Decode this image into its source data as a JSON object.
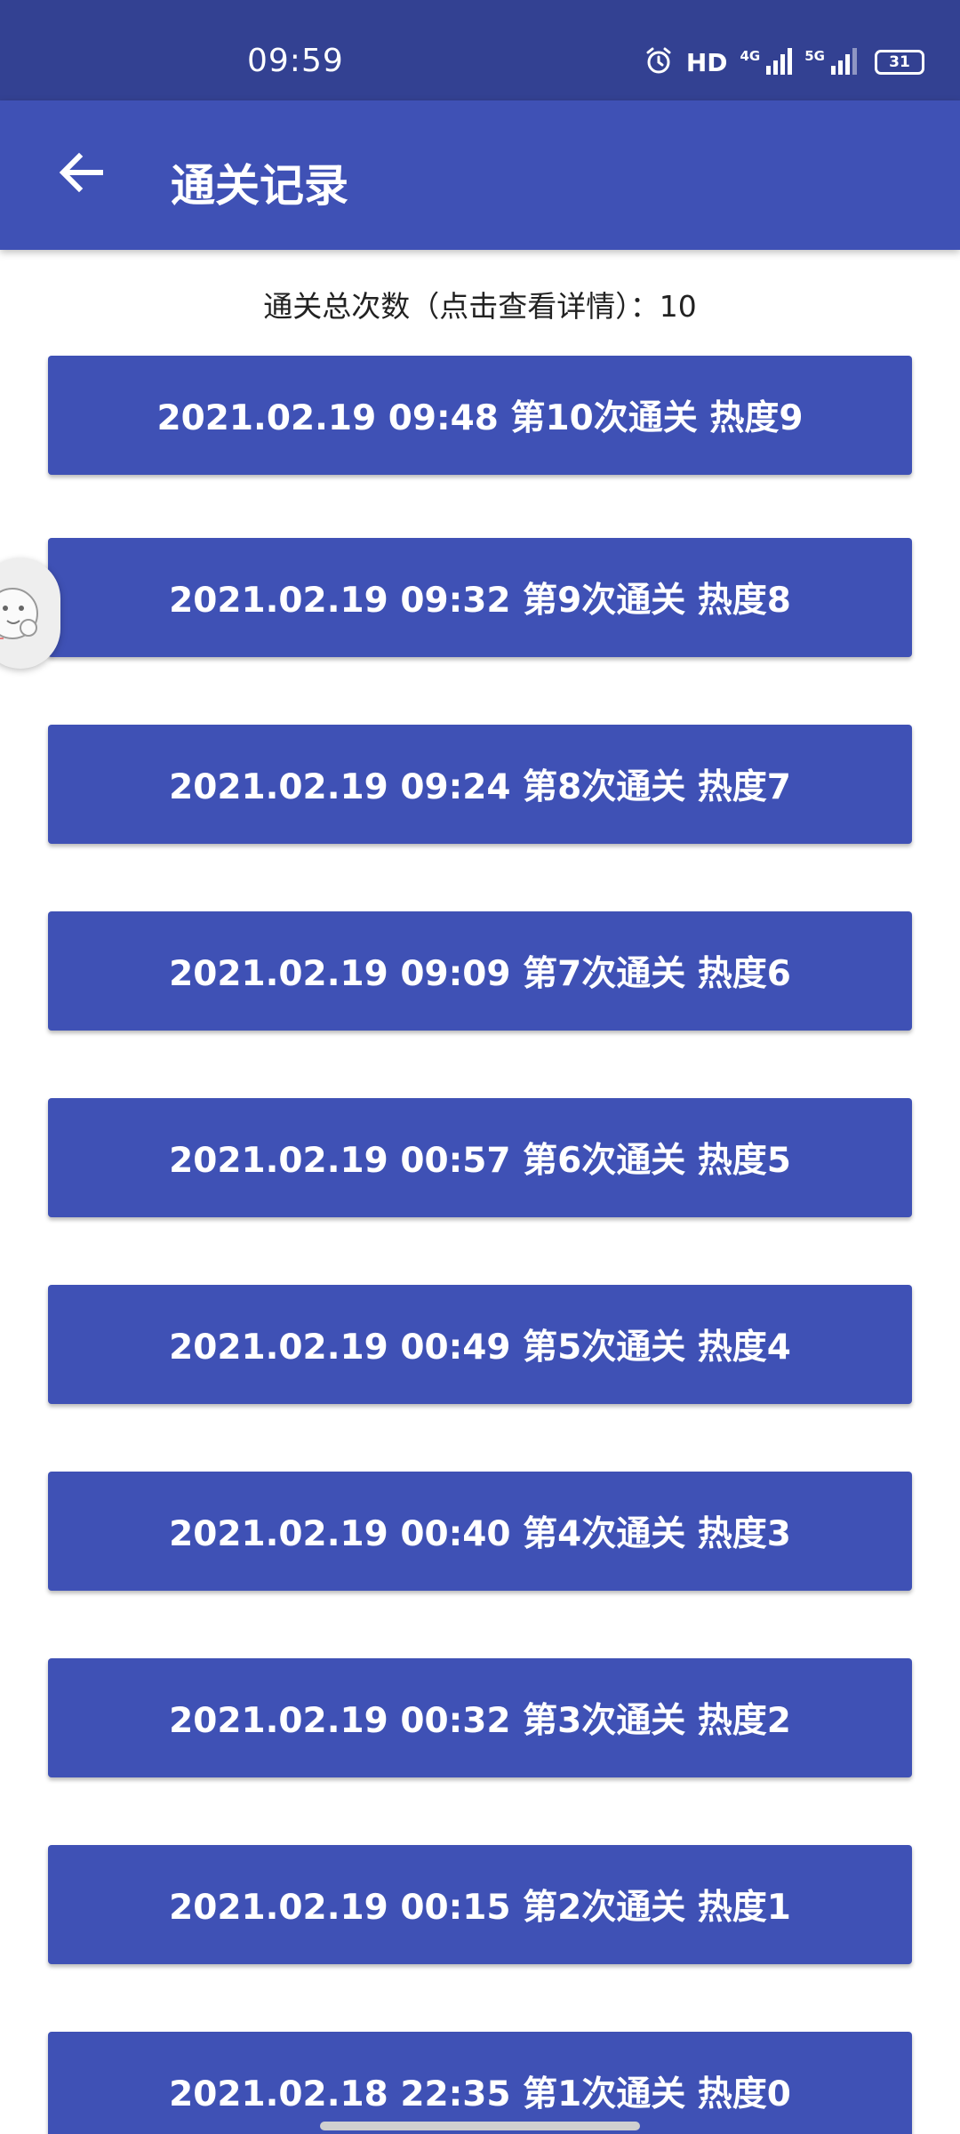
{
  "status": {
    "time": "09:59",
    "hd": "HD",
    "network_1": "4G",
    "network_2": "5G",
    "battery": "31"
  },
  "header": {
    "title": "通关记录",
    "back_icon": "arrow-left-icon"
  },
  "summary": {
    "text": "通关总次数（点击查看详情）：10"
  },
  "records": [
    "2021.02.19 09:48 第10次通关 热度9",
    "2021.02.19 09:32 第9次通关 热度8",
    "2021.02.19 09:24 第8次通关 热度7",
    "2021.02.19 09:09 第7次通关 热度6",
    "2021.02.19 00:57 第6次通关 热度5",
    "2021.02.19 00:49 第5次通关 热度4",
    "2021.02.19 00:40 第4次通关 热度3",
    "2021.02.19 00:32 第3次通关 热度2",
    "2021.02.19 00:15 第2次通关 热度1",
    "2021.02.18 22:35 第1次通关 热度0"
  ],
  "colors": {
    "primary": "#3f51b5",
    "status_bar": "#334192"
  }
}
